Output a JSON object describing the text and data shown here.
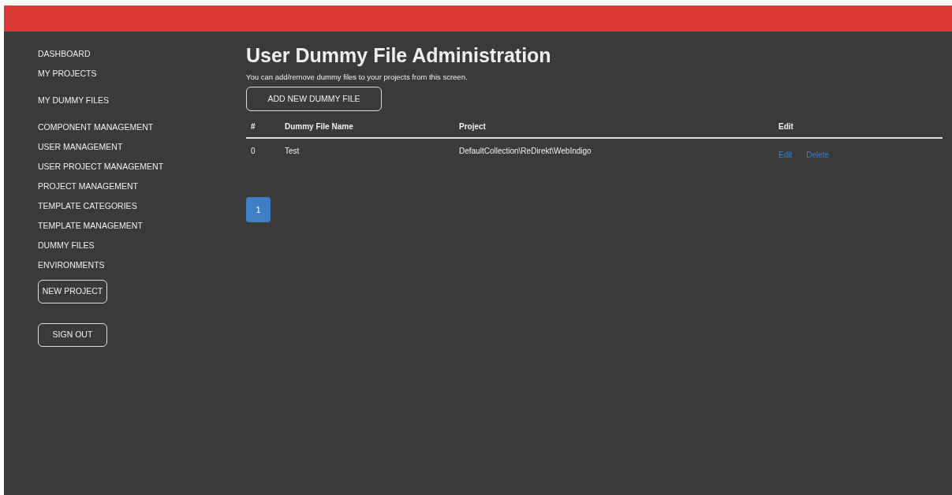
{
  "sidebar": {
    "sections": [
      {
        "items": [
          "DASHBOARD",
          "MY PROJECTS"
        ]
      },
      {
        "items": [
          "MY DUMMY FILES"
        ]
      },
      {
        "items": [
          "COMPONENT MANAGEMENT",
          "USER MANAGEMENT",
          "USER PROJECT MANAGEMENT",
          "PROJECT MANAGEMENT",
          "TEMPLATE CATEGORIES",
          "TEMPLATE MANAGEMENT",
          "DUMMY FILES",
          "ENVIRONMENTS"
        ]
      }
    ],
    "buttons": [
      "NEW PROJECT",
      "SIGN OUT"
    ]
  },
  "page": {
    "title": "User Dummy File Administration",
    "subtitle": "You can add/remove dummy files to your projects from this screen.",
    "add_button": "ADD NEW DUMMY FILE"
  },
  "table": {
    "columns": [
      "#",
      "Dummy File Name",
      "Project",
      "Edit"
    ],
    "rows": [
      {
        "cells": [
          "0",
          "Test",
          "DefaultCollection\\ReDirekt\\WebIndigo"
        ],
        "actions": [
          "Edit",
          "Delete"
        ]
      }
    ]
  },
  "pagination": [
    {
      "label": "1",
      "selected": true
    }
  ]
}
